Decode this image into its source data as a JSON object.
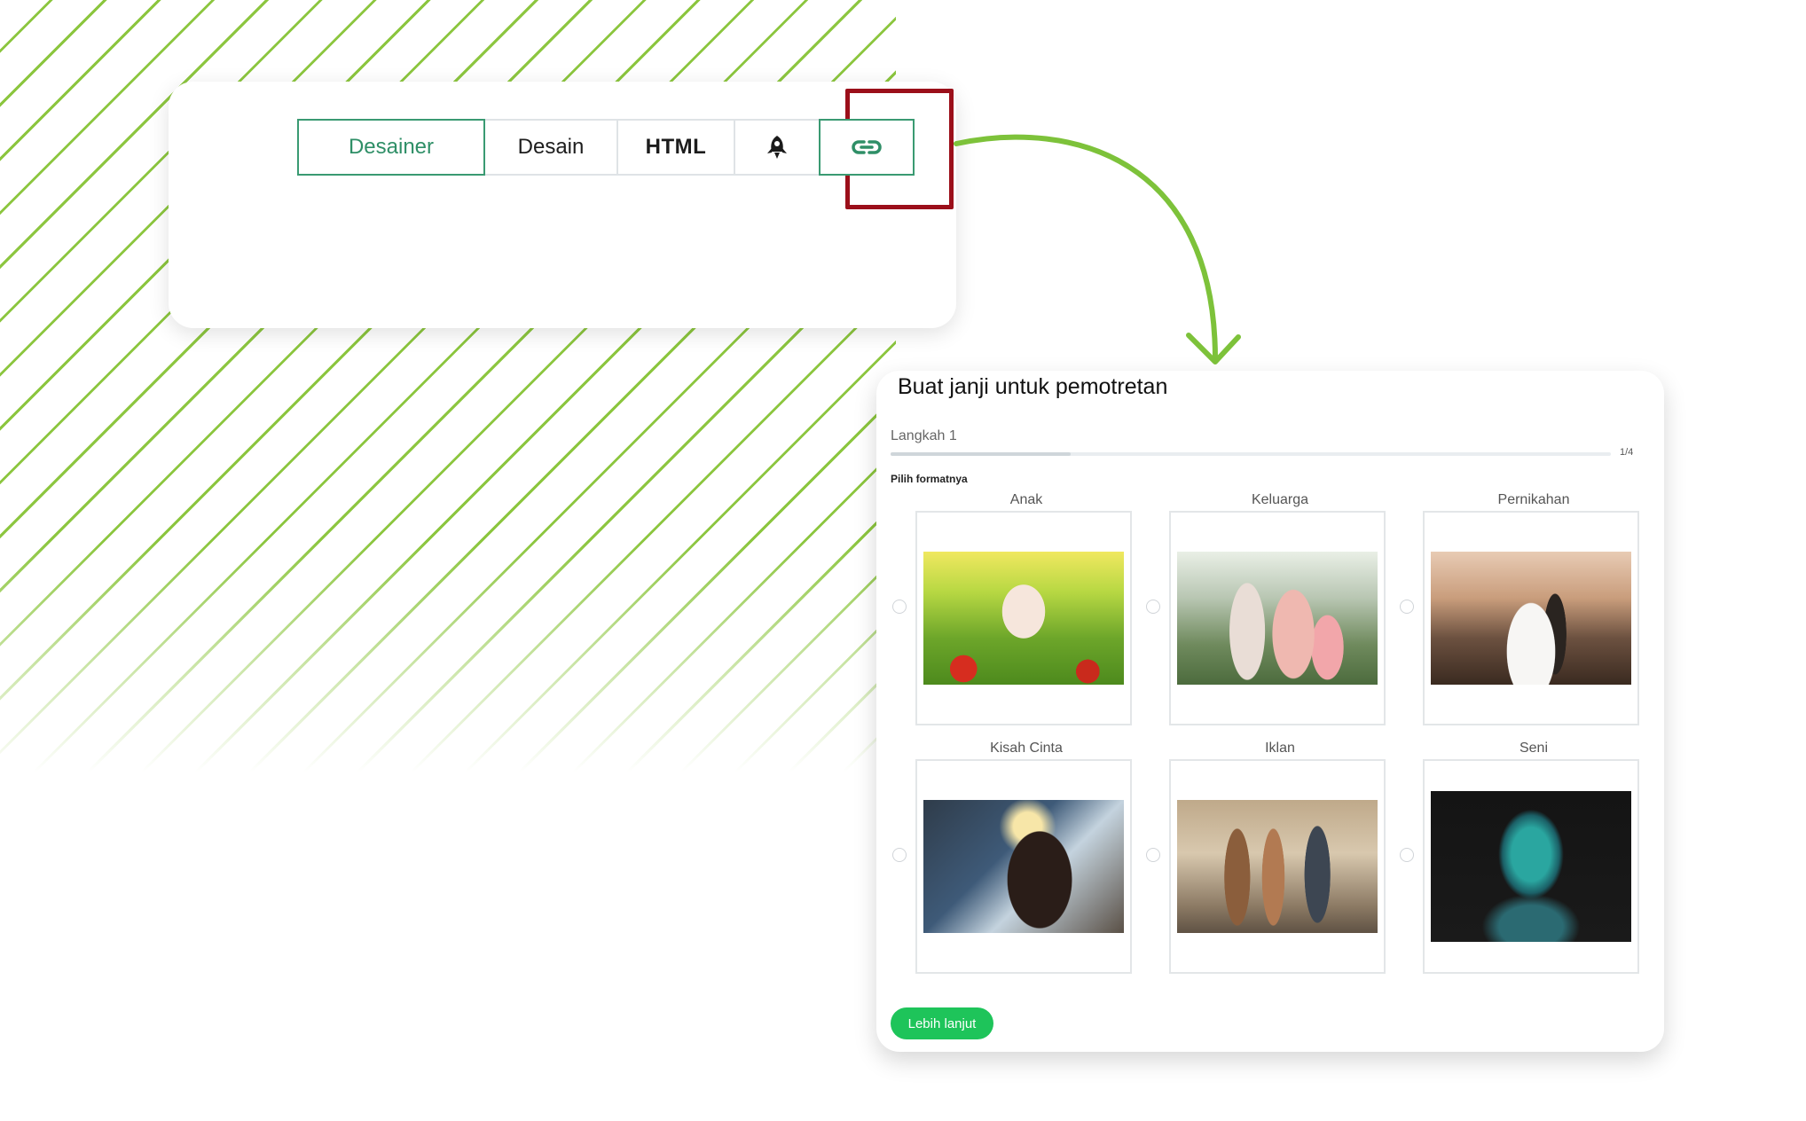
{
  "toolbar": {
    "tabs": [
      {
        "label": "Desainer"
      },
      {
        "label": "Desain"
      },
      {
        "label": "HTML"
      }
    ],
    "icons": {
      "rocket": "rocket-icon",
      "link": "link-icon"
    }
  },
  "form": {
    "title": "Buat janji untuk pemotretan",
    "step_label": "Langkah 1",
    "progress": {
      "current": 1,
      "total": 4,
      "text": "1/4"
    },
    "section_label": "Pilih formatnya",
    "options": [
      {
        "label": "Anak",
        "image": "photo-baby-in-grass"
      },
      {
        "label": "Keluarga",
        "image": "photo-family"
      },
      {
        "label": "Pernikahan",
        "image": "photo-wedding-couple"
      },
      {
        "label": "Kisah Cinta",
        "image": "photo-couple-winter"
      },
      {
        "label": "Iklan",
        "image": "photo-fashion-group"
      },
      {
        "label": "Seni",
        "image": "photo-art-makeup"
      }
    ],
    "next_button": "Lebih lanjut"
  },
  "colors": {
    "accent_green": "#3a9a72",
    "stripe_green": "#8cc63f",
    "highlight_red": "#9b0f1a",
    "button_green": "#1ec45a"
  }
}
